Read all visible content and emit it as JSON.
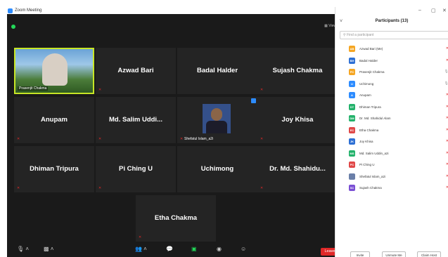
{
  "window": {
    "title": "Zoom Meeting"
  },
  "stage": {
    "view_label": "View"
  },
  "tiles": {
    "active": {
      "label": "Prasenjit Chakma"
    },
    "r1c2": "Azwad Bari",
    "r1c3": "Badal Halder",
    "r1c4": "Sujash Chakma",
    "r2c1": "Anupam",
    "r2c2": "Md. Salim Uddi...",
    "r2c3": {
      "label": "Shefatul Islam_a2i"
    },
    "r2c4": "Joy Khisa",
    "r3c1": "Dhiman Tripura",
    "r3c2": "Pi Ching U",
    "r3c3": "Uchimong",
    "r3c4": "Dr. Md. Shahidu...",
    "r4": "Etha Chakma"
  },
  "toolbar": {
    "leave": "Leave"
  },
  "participants": {
    "title": "Participants (13)",
    "search_placeholder": "Find a participant",
    "list": [
      {
        "initials": "AB",
        "name": "Azwad Bari (Me)",
        "color": "#f5a623"
      },
      {
        "initials": "BH",
        "name": "Badal Halder",
        "color": "#2d6fd4"
      },
      {
        "initials": "PC",
        "name": "Prasenjit Chakma",
        "color": "#f5a623"
      },
      {
        "initials": "U",
        "name": "Uchimong",
        "color": "#2d8cff"
      },
      {
        "initials": "A",
        "name": "Anupam",
        "color": "#2d8cff"
      },
      {
        "initials": "DT",
        "name": "Dhiman Tripura",
        "color": "#23b26b"
      },
      {
        "initials": "DM",
        "name": "Dr. Md. Shahidul Alam",
        "color": "#23b26b"
      },
      {
        "initials": "EC",
        "name": "Etha Chakma",
        "color": "#e04848"
      },
      {
        "initials": "JK",
        "name": "Joy Khisa",
        "color": "#2d6fd4"
      },
      {
        "initials": "MS",
        "name": "Md. Salim Uddin_a2i",
        "color": "#23b26b"
      },
      {
        "initials": "PC",
        "name": "Pi Ching U",
        "color": "#e04848"
      },
      {
        "initials": "",
        "name": "Shefatul Islam_a2i",
        "color": "#6a7fa8"
      },
      {
        "initials": "SC",
        "name": "Sujash Chakma",
        "color": "#7a4fd4"
      }
    ],
    "buttons": {
      "invite": "Invite",
      "unmute_me": "Unmute Me",
      "claim_host": "Claim Host"
    }
  }
}
